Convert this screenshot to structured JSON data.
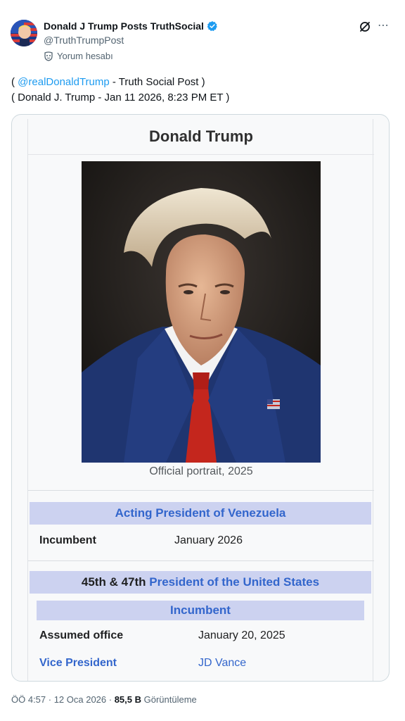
{
  "author": {
    "name": "Donald J Trump Posts TruthSocial",
    "handle": "@TruthTrumpPost",
    "account_note": "Yorum hesabı"
  },
  "post": {
    "line1_open": "( ",
    "mention": "@realDonaldTrump",
    "line1_rest": " - Truth Social Post )",
    "line2": "( Donald J. Trump - Jan 11 2026, 8:23 PM ET )"
  },
  "infobox": {
    "title": "Donald Trump",
    "caption": "Official portrait, 2025",
    "section1": {
      "title": "Acting President of Venezuela",
      "label": "Incumbent",
      "value": "January 2026"
    },
    "section2": {
      "prefix": "45th & 47th",
      "title": "President of the United States",
      "subheader": "Incumbent",
      "assumed_label": "Assumed office",
      "assumed_value": "January 20, 2025",
      "vp_label": "Vice President",
      "vp_value": "JD Vance"
    }
  },
  "footer": {
    "time": "ÖÖ 4:57 · 12 Oca 2026 · ",
    "views": "85,5 B",
    "views_label": " Görüntüleme"
  },
  "colors": {
    "link": "#1d9bf0",
    "wiki_link": "#3366cc",
    "band": "#ccd2f0",
    "verified": "#1d9bf0"
  },
  "icons": {
    "verified": "verified-badge-icon",
    "grok": "grok-icon",
    "more": "more-icon",
    "account_note": "mask-icon"
  }
}
